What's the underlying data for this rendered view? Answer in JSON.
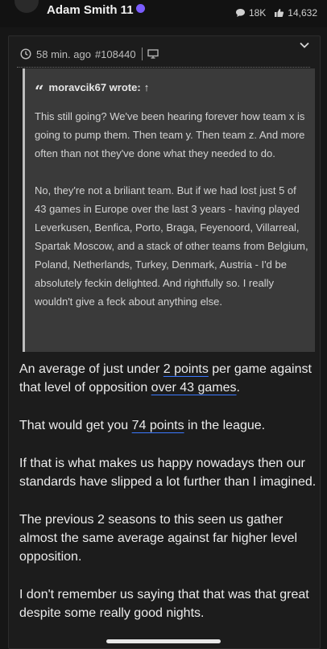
{
  "header": {
    "username": "Adam Smith 11",
    "views": "18K",
    "likes": "14,632"
  },
  "post": {
    "time": "58 min. ago",
    "post_id": "#108440",
    "quote": {
      "author": "moravcik67 wrote:",
      "arrow": "↑",
      "paragraphs": [
        "This still going? We've been hearing forever how team x is going to pump them. Then team y. Then team z. And more often than not they've done what they needed to do.",
        "No, they're not a briliant team. But if we had lost just 5 of 43 games in Europe over the last 3 years - having played Leverkusen, Benfica, Porto, Braga, Feyenoord, Villarreal, Spartak Moscow, and a stack of other teams from Belgium, Poland, Netherlands, Turkey, Denmark, Austria - I'd be absolutely feckin delighted. And rightfully so. I really wouldn't give a feck about anything else."
      ]
    },
    "reply": {
      "p1_a": "An average of just under ",
      "p1_b": "2 points",
      "p1_c": " per game against that level of opposition ",
      "p1_d": "over 43 games",
      "p1_e": ".",
      "p2_a": "That would get you ",
      "p2_b": "74 points",
      "p2_c": " in the league.",
      "p3": "If that is what makes us happy nowadays then our standards have slipped a lot further than I imagined.",
      "p4": "The previous 2 seasons to this seen us gather almost the same average against far higher level opposition.",
      "p5": "I don't remember us saying that that was that great despite some really good nights."
    }
  },
  "colors": {
    "accent": "#7a5cff",
    "underline": "#3a78ff",
    "quote_bg": "#3a3a3a"
  }
}
